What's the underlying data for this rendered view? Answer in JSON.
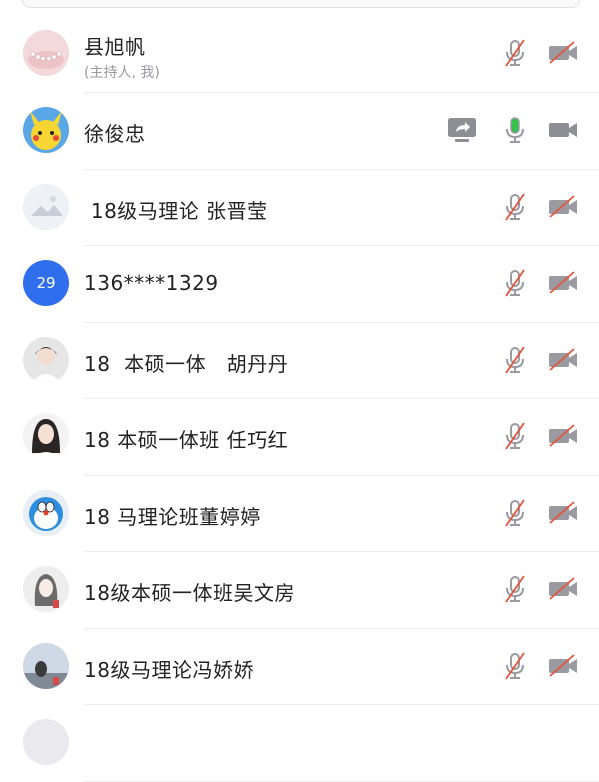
{
  "colors": {
    "muted_icon": "#9a9aa0",
    "mute_slash": "#e2553f",
    "active_mic": "#33c24d",
    "accent_blue": "#2f6fee"
  },
  "participants": [
    {
      "name": "县旭帆",
      "subtitle": "(主持人, 我)",
      "mic": "muted",
      "camera": "off",
      "avatar_icon": "pearl-necklace-avatar"
    },
    {
      "name": "徐俊忠",
      "mic": "active",
      "camera": "on",
      "sharing": true,
      "avatar_icon": "pikachu-avatar"
    },
    {
      "name": " 18级马理论 张晋莹",
      "mic": "muted",
      "camera": "off",
      "avatar_icon": "landscape-placeholder-avatar"
    },
    {
      "name": "136****1329",
      "mic": "muted",
      "camera": "off",
      "avatar_text": "29"
    },
    {
      "name": "18  本硕一体   胡丹丹",
      "mic": "muted",
      "camera": "off",
      "avatar_icon": "girl-photo-avatar"
    },
    {
      "name": "18 本硕一体班 任巧红",
      "mic": "muted",
      "camera": "off",
      "avatar_icon": "girl-photo-avatar"
    },
    {
      "name": "18 马理论班董婷婷",
      "mic": "muted",
      "camera": "off",
      "avatar_icon": "doraemon-avatar"
    },
    {
      "name": "18级本硕一体班吴文房",
      "mic": "muted",
      "camera": "off",
      "avatar_icon": "girl-drawing-avatar"
    },
    {
      "name": "18级马理论冯娇娇",
      "mic": "muted",
      "camera": "off",
      "avatar_icon": "sky-photo-avatar"
    }
  ]
}
